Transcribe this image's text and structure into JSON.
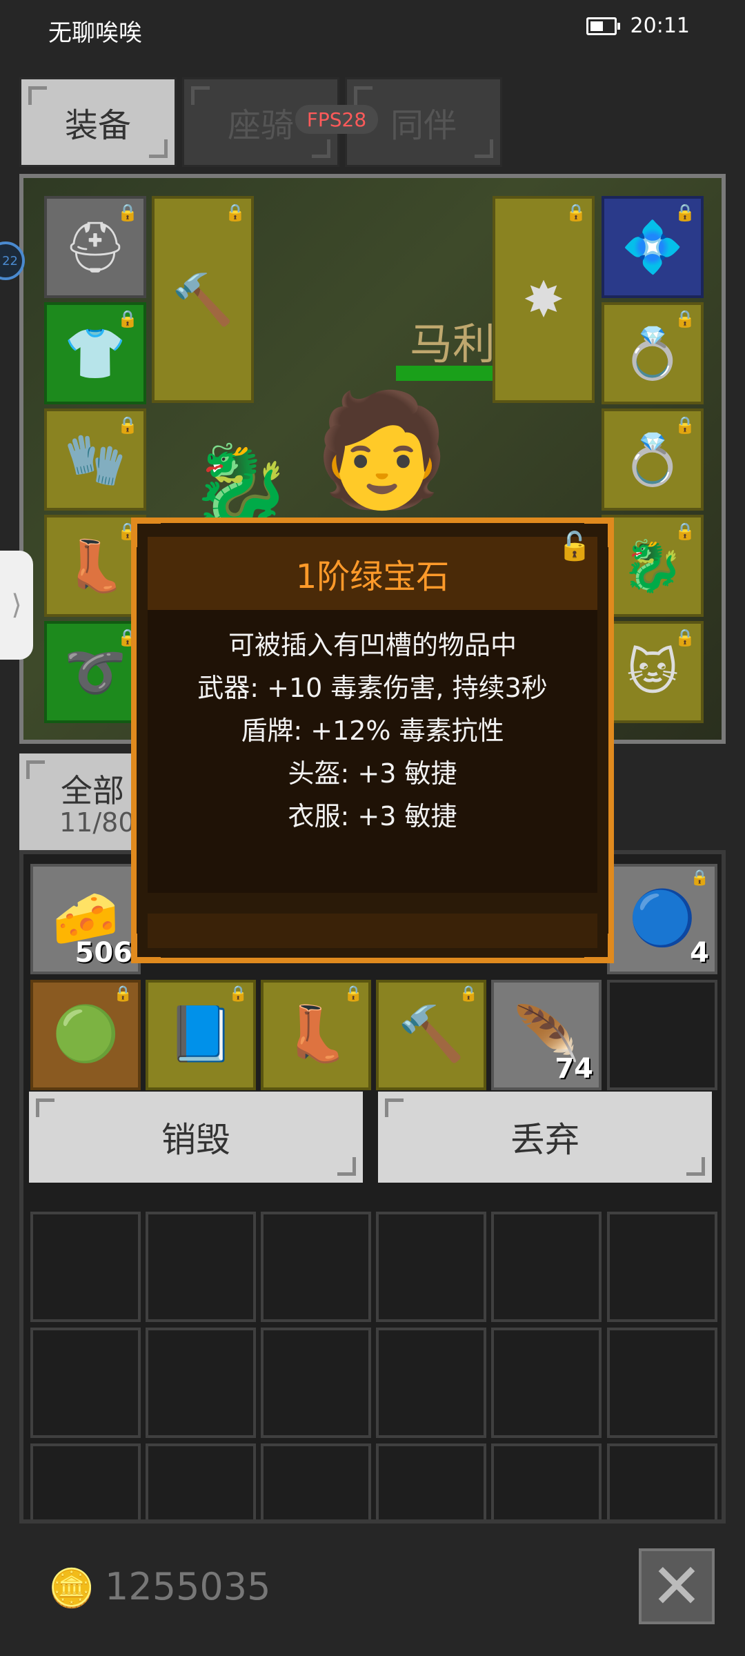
{
  "status_bar": {
    "app_name": "无聊唉唉",
    "time": "20:11"
  },
  "tabs": [
    {
      "label": "装备",
      "active": true
    },
    {
      "label": "座骑",
      "active": false
    },
    {
      "label": "同伴",
      "active": false
    }
  ],
  "fps": "FPS28",
  "character": {
    "name": "马利"
  },
  "side_badge": "22",
  "side_handle_icon": "⟩",
  "equip_icons": {
    "helmet": "⛑",
    "armor": "👕",
    "gloves": "🧤",
    "boots": "👢",
    "belt": "➰",
    "weapon": "🔨",
    "shield_spike": "✸",
    "necklace": "💠",
    "ring1": "💍",
    "ring2": "💍",
    "mount": "🐉",
    "pet": "🐱"
  },
  "filter": {
    "label": "全部",
    "count": "11/80"
  },
  "inventory": {
    "row1": [
      {
        "icon": "🧀",
        "count": "506"
      },
      {
        "icon": "🔵",
        "count": "4"
      }
    ],
    "row2": [
      {
        "icon": "🟢",
        "count": ""
      },
      {
        "icon": "📘",
        "count": ""
      },
      {
        "icon": "👢",
        "count": ""
      },
      {
        "icon": "🔨",
        "count": ""
      },
      {
        "icon": "🪶",
        "count": "74"
      }
    ]
  },
  "actions": {
    "destroy": "销毁",
    "discard": "丢弃"
  },
  "tooltip": {
    "title": "1阶绿宝石",
    "lines": [
      "可被插入有凹槽的物品中",
      "武器: +10 毒素伤害, 持续3秒",
      "盾牌: +12% 毒素抗性",
      "头盔: +3 敏捷",
      "衣服: +3 敏捷"
    ],
    "lock_icon": "🔓"
  },
  "footer": {
    "gold": "1255035",
    "gold_icon": "🪙",
    "close_icon": "✕"
  },
  "colors": {
    "tooltip_border": "#e08a1e",
    "tooltip_title": "#ff9a2a",
    "fps": "#ff5a5a"
  }
}
